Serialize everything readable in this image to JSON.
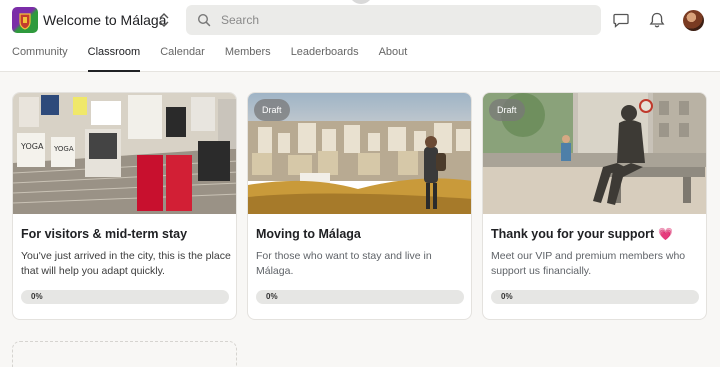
{
  "app": {
    "title": "Welcome to Málaga"
  },
  "search": {
    "placeholder": "Search"
  },
  "tabs": [
    {
      "label": "Community",
      "active": false
    },
    {
      "label": "Classroom",
      "active": true
    },
    {
      "label": "Calendar",
      "active": false
    },
    {
      "label": "Members",
      "active": false
    },
    {
      "label": "Leaderboards",
      "active": false
    },
    {
      "label": "About",
      "active": false
    }
  ],
  "icons": {
    "chat": "chat-icon",
    "notifications": "bell-icon",
    "switch": "chevron-updown-icon",
    "search": "search-icon"
  },
  "courses": [
    {
      "title": "For visitors & mid-term stay",
      "description": "You've just arrived in the city, this is the place that will help you adapt quickly.",
      "draft": false,
      "progress_label": "0%",
      "progress": 0
    },
    {
      "title": "Moving to Málaga",
      "description": "For those who want to stay and live in Málaga.",
      "draft": true,
      "draft_label": "Draft",
      "progress_label": "0%",
      "progress": 0
    },
    {
      "title": "Thank you for your support",
      "emoji": "💗",
      "description": "Meet our VIP and premium members who support us financially.",
      "draft": true,
      "draft_label": "Draft",
      "progress_label": "0%",
      "progress": 0
    }
  ],
  "colors": {
    "accent": "#202124",
    "progress_track": "#e6e6e4",
    "heart": "#e64d8a"
  }
}
